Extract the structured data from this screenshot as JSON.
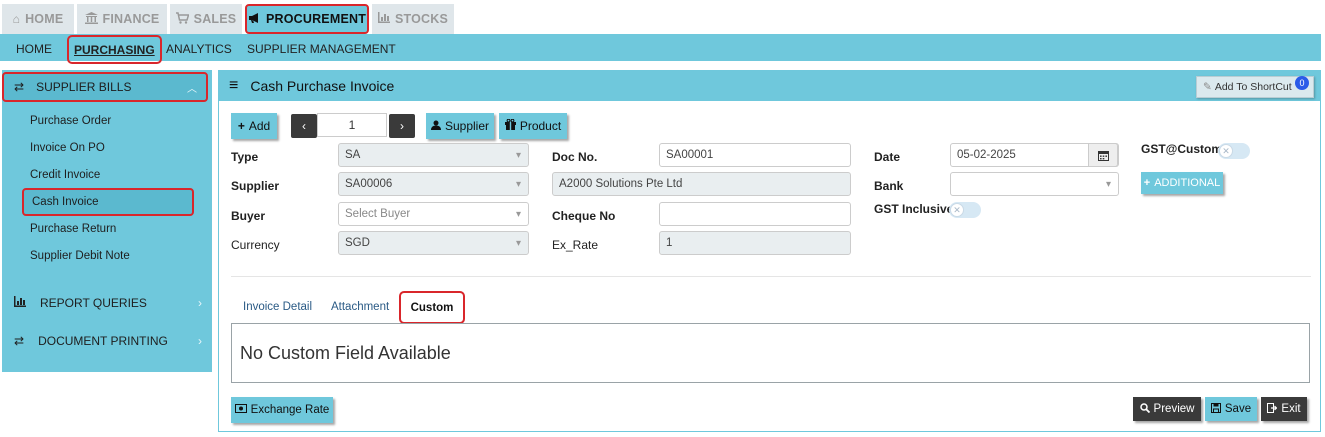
{
  "top_tabs": [
    {
      "label": "HOME",
      "icon": "home-icon",
      "glyph": "⌂"
    },
    {
      "label": "FINANCE",
      "icon": "bank-icon",
      "glyph": "🏛"
    },
    {
      "label": "SALES",
      "icon": "cart-icon",
      "glyph": "🛒"
    },
    {
      "label": "PROCUREMENT",
      "icon": "megaphone-icon",
      "glyph": "📢"
    },
    {
      "label": "STOCKS",
      "icon": "bar-chart-icon",
      "glyph": "▮"
    }
  ],
  "subnav": [
    "HOME",
    "PURCHASING",
    "ANALYTICS",
    "SUPPLIER MANAGEMENT"
  ],
  "sidebar": {
    "header": "SUPPLIER BILLS",
    "items": [
      "Purchase Order",
      "Invoice On PO",
      "Credit Invoice",
      "Cash Invoice",
      "Purchase Return",
      "Supplier Debit Note"
    ],
    "groups": [
      "REPORT QUERIES",
      "DOCUMENT PRINTING"
    ]
  },
  "panel": {
    "title": "Cash Purchase Invoice",
    "shortcut_label": "Add To ShortCut",
    "shortcut_count": "0"
  },
  "toolbar": {
    "add": "Add",
    "page": "1",
    "supplier": "Supplier",
    "product": "Product"
  },
  "form": {
    "type_label": "Type",
    "type_value": "SA",
    "supplier_label": "Supplier",
    "supplier_value": "SA00006",
    "buyer_label": "Buyer",
    "buyer_placeholder": "Select Buyer",
    "currency_label": "Currency",
    "currency_value": "SGD",
    "docno_label": "Doc No.",
    "docno_value": "SA00001",
    "supplier_name": "A2000 Solutions Pte Ltd",
    "cheque_label": "Cheque No",
    "cheque_value": "",
    "exrate_label": "Ex_Rate",
    "exrate_value": "1",
    "date_label": "Date",
    "date_value": "05-02-2025",
    "bank_label": "Bank",
    "bank_value": "",
    "gst_inclusive_label": "GST Inclusive",
    "gst_custom_label": "GST@Custom",
    "additional": "ADDITIONAL"
  },
  "tabs": [
    "Invoice Detail",
    "Attachment",
    "Custom"
  ],
  "custom_message": "No Custom Field Available",
  "buttons": {
    "exchange_rate": "Exchange Rate",
    "preview": "Preview",
    "save": "Save",
    "exit": "Exit"
  },
  "colors": {
    "accent": "#6fc8dc",
    "highlight": "#d9262b",
    "dark": "#3a3a3a"
  }
}
